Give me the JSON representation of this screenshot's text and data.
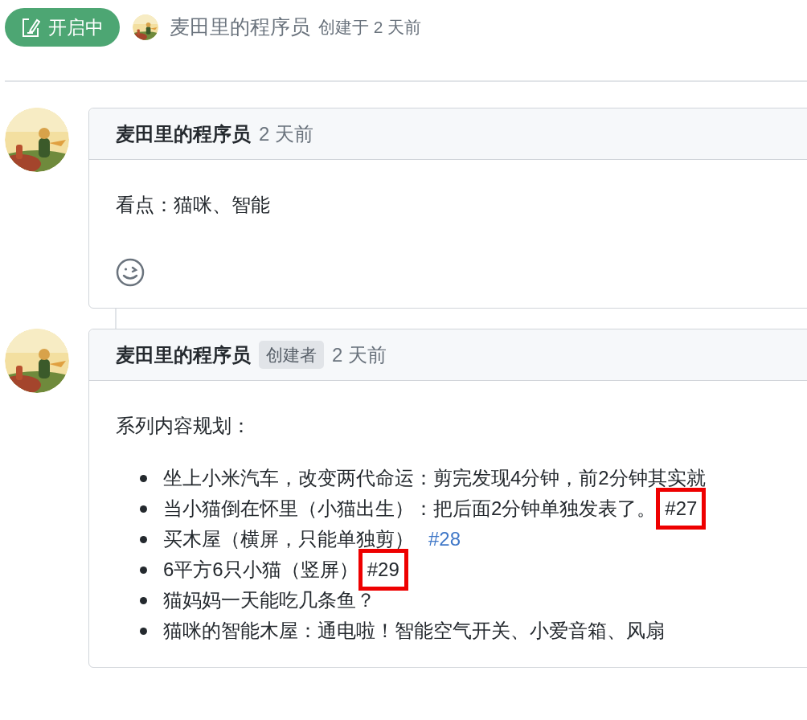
{
  "issue": {
    "state": {
      "label": "开启中",
      "open": true
    },
    "author": "麦田里的程序员",
    "created": "创建于 2 天前"
  },
  "comments": [
    {
      "author": "麦田里的程序员",
      "time": "2 天前",
      "paragraphs": [
        "看点：猫咪、智能"
      ],
      "reactions": true
    },
    {
      "author": "麦田里的程序员",
      "role": "创建者",
      "time": "2 天前",
      "paragraphs": [
        "系列内容规划："
      ],
      "list": [
        {
          "text": "坐上小米汽车，改变两代命运：剪完发现4分钟，前2分钟其实就"
        },
        {
          "text": "当小猫倒在怀里（小猫出生）：把后面2分钟单独发表了。",
          "ref": {
            "label": "#27",
            "kind": "plain",
            "highlighted": true
          }
        },
        {
          "text": "买木屋（横屏，只能单独剪）",
          "ref": {
            "label": "#28",
            "kind": "link",
            "highlighted": false
          }
        },
        {
          "text": "6平方6只小猫（竖屏）",
          "ref": {
            "label": "#29",
            "kind": "plain",
            "highlighted": true
          }
        },
        {
          "text": "猫妈妈一天能吃几条鱼？"
        },
        {
          "text": "猫咪的智能木屋：通电啦！智能空气开关、小爱音箱、风扇"
        }
      ]
    }
  ]
}
